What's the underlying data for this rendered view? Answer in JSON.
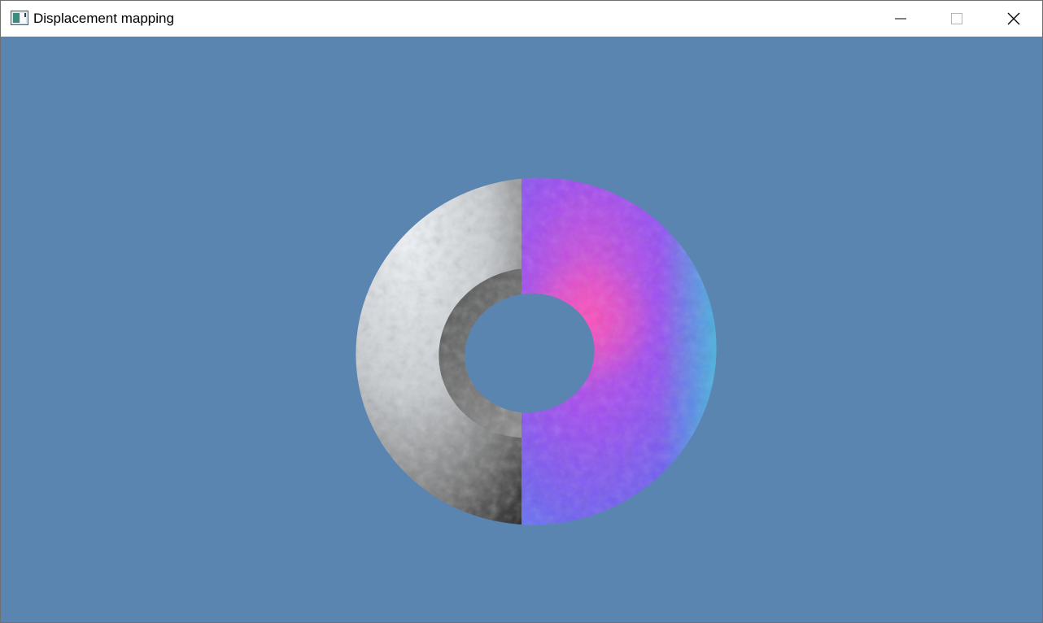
{
  "window": {
    "title": "Displacement mapping",
    "icon": "application-window-icon",
    "controls": {
      "minimize": "minimize-icon",
      "maximize": "maximize-icon",
      "close": "close-icon"
    }
  },
  "viewport": {
    "background_color": "#5a85b0",
    "scene": "torus-split-view",
    "left_half_shading": "grayscale-lit",
    "right_half_shading": "normal-map-colors",
    "colors": {
      "gray_light": "#f2f6fa",
      "gray_dark": "#262626",
      "normal_pink": "#e04fd0",
      "normal_purple": "#8a4bf0",
      "normal_blue": "#6a6cf0",
      "normal_cyan": "#38d2d6"
    }
  }
}
